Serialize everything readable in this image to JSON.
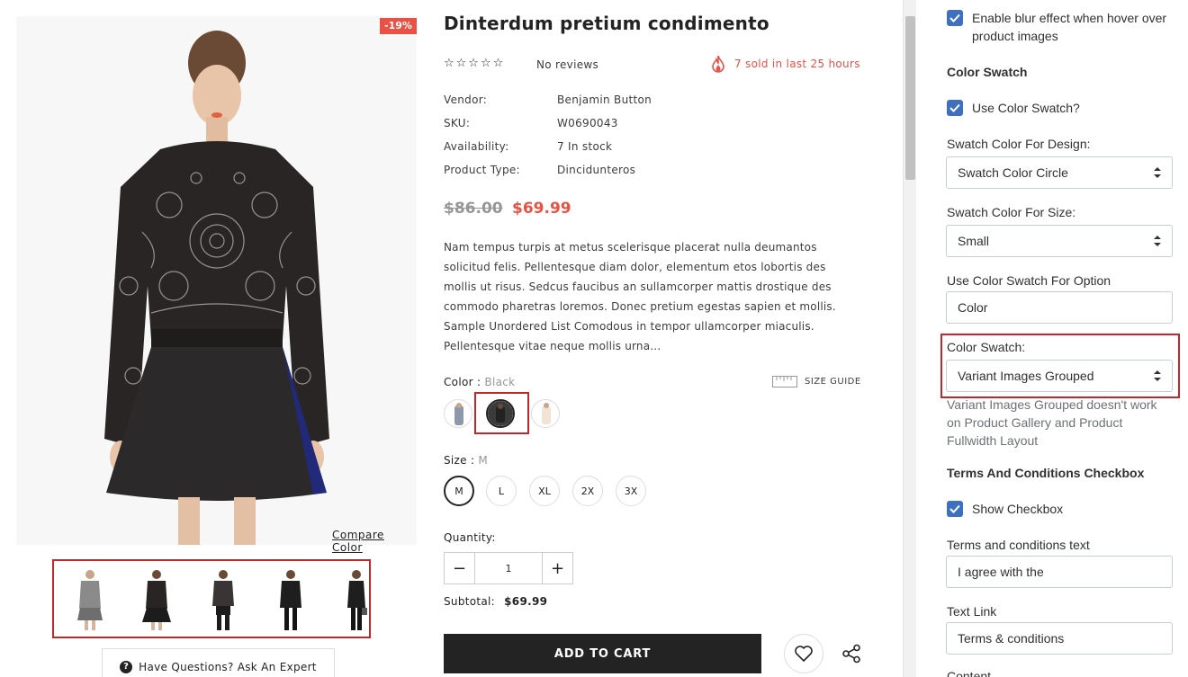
{
  "product": {
    "badge": "-19%",
    "title": "Dinterdum pretium condimento",
    "stars": "☆☆☆☆☆",
    "reviews": "No reviews",
    "sold": "7 sold in last 25 hours",
    "info": [
      {
        "label": "Vendor:",
        "value": "Benjamin Button"
      },
      {
        "label": "SKU:",
        "value": "W0690043"
      },
      {
        "label": "Availability:",
        "value": "7 In stock"
      },
      {
        "label": "Product Type:",
        "value": "Dincidunteros"
      }
    ],
    "price_old": "$86.00",
    "price_new": "$69.99",
    "description": "Nam tempus turpis at metus scelerisque placerat nulla deumantos solicitud felis. Pellentesque diam dolor, elementum etos lobortis des mollis ut risus. Sedcus faucibus an sullamcorper mattis drostique des commodo pharetras loremos. Donec pretium egestas sapien et mollis. Sample Unordered List Comodous in tempor ullamcorper miaculis. Pellentesque vitae neque mollis urna...",
    "color_label": "Color :",
    "color_selected": "Black",
    "size_guide": "SIZE GUIDE",
    "size_label": "Size :",
    "size_selected": "M",
    "sizes": [
      "M",
      "L",
      "XL",
      "2X",
      "3X"
    ],
    "qty_label": "Quantity:",
    "qty_value": "1",
    "qty_minus": "−",
    "qty_plus": "+",
    "subtotal_label": "Subtotal:",
    "subtotal_value": "$69.99",
    "add_to_cart": "ADD TO CART",
    "compare_color": "Compare Color",
    "ask_expert": "Have Questions? Ask An Expert",
    "ask_icon": "?"
  },
  "settings": {
    "blur_hover_label": "Enable blur effect when hover over product images",
    "color_swatch_heading": "Color Swatch",
    "use_color_swatch_label": "Use Color Swatch?",
    "swatch_design_label": "Swatch Color For Design:",
    "swatch_design_value": "Swatch Color Circle",
    "swatch_size_label": "Swatch Color For Size:",
    "swatch_size_value": "Small",
    "swatch_option_label": "Use Color Swatch For Option",
    "swatch_option_value": "Color",
    "color_swatch_label": "Color Swatch:",
    "color_swatch_value": "Variant Images Grouped",
    "color_swatch_hint": "Variant Images Grouped doesn't work on Product Gallery and Product Fullwidth Layout",
    "terms_heading": "Terms And Conditions Checkbox",
    "show_checkbox_label": "Show Checkbox",
    "terms_text_label": "Terms and conditions text",
    "terms_text_value": "I agree with the",
    "text_link_label": "Text Link",
    "text_link_value": "Terms & conditions",
    "content_label": "Content"
  },
  "colors": {
    "accent_red": "#e95144",
    "highlight_red": "#c0272d",
    "checkbox_blue": "#3f6fbf",
    "dark": "#232323"
  }
}
